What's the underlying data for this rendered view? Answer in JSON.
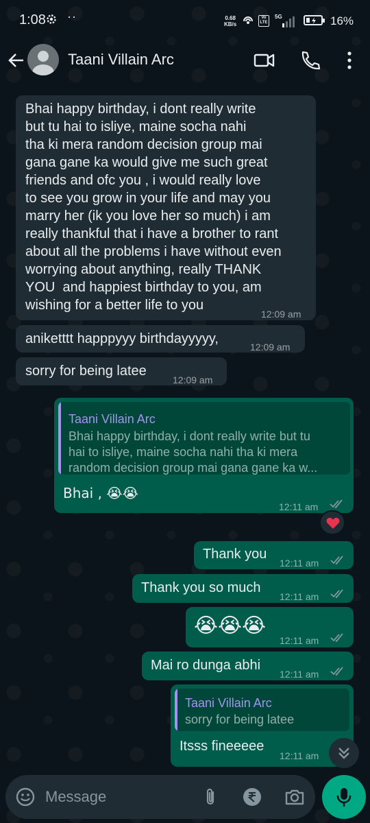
{
  "status_bar": {
    "time": "1:08",
    "dots": "··",
    "speed_value": "0.68",
    "speed_unit": "KB/s",
    "network": "5G",
    "volte": "Vo LTE",
    "battery_percent": "16%"
  },
  "header": {
    "contact_name": "Taani Villain Arc",
    "icons": [
      "back-arrow-icon",
      "avatar",
      "video-call-icon",
      "voice-call-icon",
      "more-options-icon"
    ]
  },
  "messages": [
    {
      "direction": "in",
      "text": "Bhai happy birthday, i dont really write\nbut tu hai to isliye, maine socha nahi\ntha ki mera random decision group mai\ngana gane ka would give me such great\nfriends and ofc you , i would really love\nto see you grow in your life and may you\nmarry her (ik you love her so much) i am\nreally thankful that i have a brother to rant\nabout all the problems i have without even\nworrying about anything, really THANK\nYOU  and happiest birthday to you, am\nwishing for a better life to you",
      "time": "12:09 am"
    },
    {
      "direction": "in",
      "text": "aniketttt happpyyy birthdayyyyy,",
      "time": "12:09 am"
    },
    {
      "direction": "in",
      "text": "sorry for being latee",
      "time": "12:09 am"
    },
    {
      "direction": "out",
      "quote_name": "Taani Villain Arc",
      "quote_text": "Bhai happy birthday, i dont really write but tu\nhai to isliye, maine socha nahi tha ki mera\nrandom decision group mai gana gane ka w...",
      "text": "Bhai , 😭😭",
      "time": "12:11 am",
      "reaction": "❤️"
    },
    {
      "direction": "out",
      "text": "Thank you",
      "time": "12:11 am"
    },
    {
      "direction": "out",
      "text": "Thank you so much",
      "time": "12:11 am"
    },
    {
      "direction": "out",
      "text": "😭😭😭",
      "time": "12:11 am"
    },
    {
      "direction": "out",
      "text": "Mai ro dunga abhi",
      "time": "12:11 am"
    },
    {
      "direction": "out",
      "quote_name": "Taani Villain Arc",
      "quote_text": "sorry for being latee",
      "text": "Itsss fineeeee",
      "time": "12:11 am"
    }
  ],
  "composer": {
    "placeholder": "Message",
    "icons": [
      "emoji-icon",
      "attach-icon",
      "rupee-payment-icon",
      "camera-icon",
      "mic-icon"
    ]
  },
  "colors": {
    "background": "#0b141a",
    "incoming_bubble": "#202c33",
    "outgoing_bubble": "#005c4b",
    "quote_name": "#a791f1",
    "accent": "#00a884",
    "read_ticks": "#8696a0"
  }
}
